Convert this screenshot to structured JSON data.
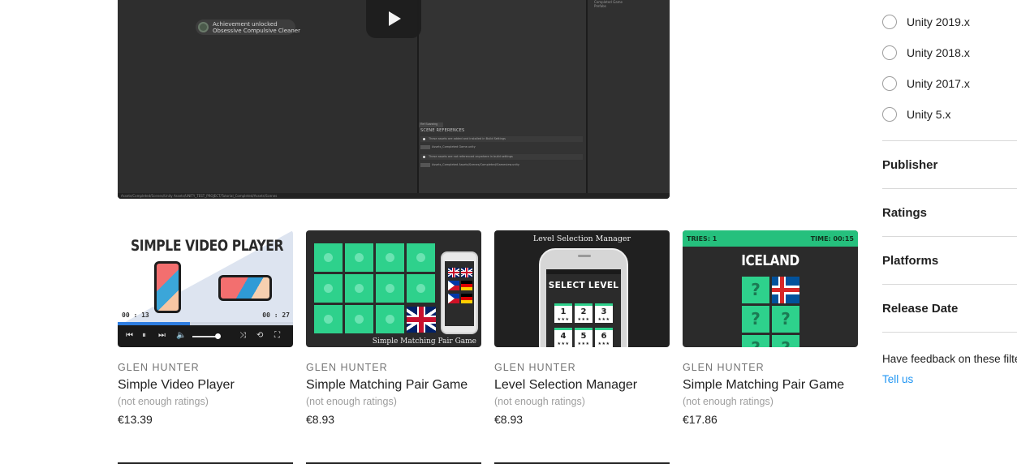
{
  "video": {
    "toast_line1": "Achievement unlocked",
    "toast_line2": "Obsessive Compulsive Cleaner",
    "scene_tab": "Ref Scanning",
    "scene_header": "SCENE REFERENCES",
    "scene_row1": "These assets are added and installed in Build Settings",
    "scene_tag1": "Assets_Completed Game.unity",
    "scene_row2": "These assets are not referenced anywhere in build settings",
    "scene_tag2": "Assets_Completed Assets/Scenes/Completed/Gameview.unity",
    "right_line1": "Completed Game",
    "right_line2": "Prefabs",
    "footer_path": "Assets/Completed/Scenes/Unity Assets/UNITY_TEST_PROJECT/Tutorial_Completed/Assets/Scenes"
  },
  "cards": [
    {
      "publisher": "GLEN HUNTER",
      "title": "Simple Video Player",
      "ratings": "(not enough ratings)",
      "price": "€13.39",
      "thumb": {
        "heading": "SIMPLE VIDEO PLAYER",
        "time_left": "00 : 13",
        "time_right": "00 : 27",
        "progress": 0.41
      }
    },
    {
      "publisher": "GLEN HUNTER",
      "title": "Simple Matching Pair Game",
      "ratings": "(not enough ratings)",
      "price": "€8.93",
      "thumb": {
        "caption": "Simple Matching Pair Game"
      }
    },
    {
      "publisher": "GLEN HUNTER",
      "title": "Level Selection Manager",
      "ratings": "(not enough ratings)",
      "price": "€8.93",
      "thumb": {
        "caption": "Level Selection Manager",
        "heading": "SELECT LEVEL",
        "levels": [
          "1",
          "2",
          "3",
          "4",
          "5",
          "6"
        ],
        "stars": "★★★"
      }
    },
    {
      "publisher": "GLEN HUNTER",
      "title": "Simple Matching Pair Game",
      "ratings": "(not enough ratings)",
      "price": "€17.86",
      "thumb": {
        "tries": "TRIES: 1",
        "time": "TIME: 00:15",
        "country": "ICELAND",
        "mark": "?"
      }
    }
  ],
  "sidebar": {
    "versions": [
      "Unity 2019.x",
      "Unity 2018.x",
      "Unity 2017.x",
      "Unity 5.x"
    ],
    "sections": [
      "Publisher",
      "Ratings",
      "Platforms",
      "Release Date"
    ],
    "feedback_text": "Have feedback on these filters?",
    "feedback_link": "Tell us"
  },
  "colors": {
    "accent_green": "#2ed18c",
    "link_blue": "#2196f3",
    "video_bg": "#303030"
  }
}
